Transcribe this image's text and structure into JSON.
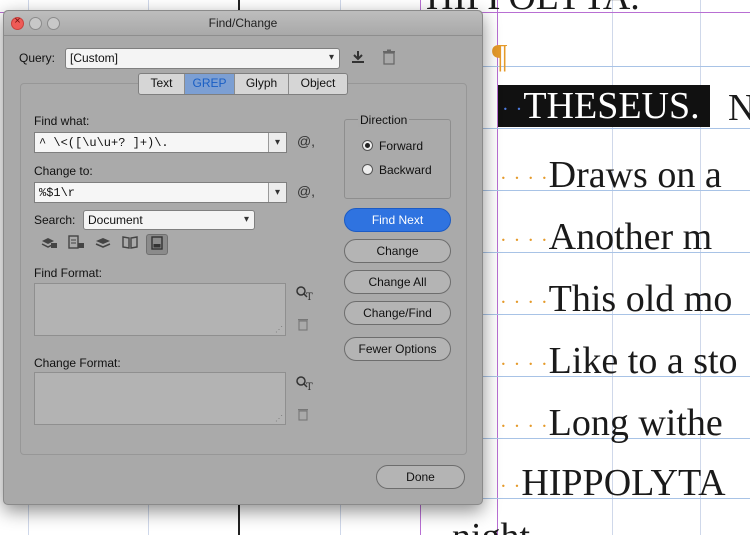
{
  "document": {
    "top_partial": "HIPPOLYTA.",
    "highlighted_line": "THESEUS.",
    "highlighted_tail": "N",
    "lines": [
      "Draws on a",
      "Another m",
      "This old mo",
      "Like to a sto",
      "Long withe",
      "HIPPOLYTA"
    ],
    "bottom_partial": "night",
    "pilcrow": "¶",
    "dots": "· · · ·"
  },
  "dialog": {
    "title": "Find/Change",
    "query_label": "Query:",
    "query_value": "[Custom]",
    "tabs": [
      {
        "label": "Text",
        "active": false
      },
      {
        "label": "GREP",
        "active": true
      },
      {
        "label": "Glyph",
        "active": false
      },
      {
        "label": "Object",
        "active": false
      }
    ],
    "find_what_label": "Find what:",
    "find_what_value": "^  \\<([\\u\\u+? ]+)\\.",
    "change_to_label": "Change to:",
    "change_to_value": "%$1\\r",
    "search_label": "Search:",
    "search_value": "Document",
    "find_format_label": "Find Format:",
    "change_format_label": "Change Format:",
    "direction_label": "Direction",
    "direction_forward": "Forward",
    "direction_backward": "Backward",
    "buttons": {
      "find_next": "Find Next",
      "change": "Change",
      "change_all": "Change All",
      "change_find": "Change/Find",
      "fewer_options": "Fewer Options",
      "done": "Done"
    },
    "glyphs": {
      "at": "@,",
      "save": "⤓",
      "trash": "🗑",
      "format_search": "Ꝑ",
      "caret": "▾"
    }
  }
}
